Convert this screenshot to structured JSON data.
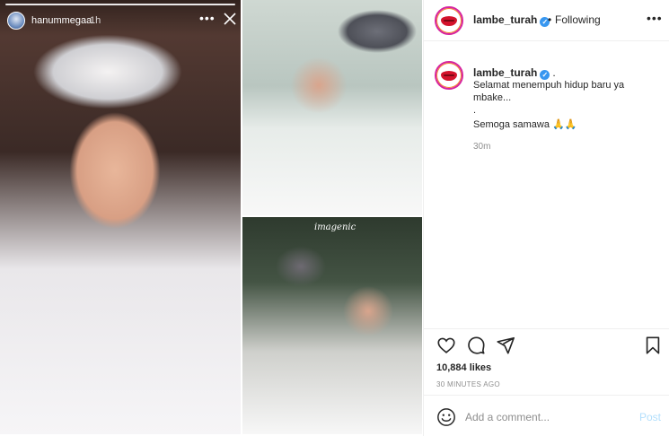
{
  "story": {
    "username": "hanummegaa",
    "time": "1h",
    "more_icon": "more-horizontal-icon",
    "close_icon": "close-icon"
  },
  "photo_watermark": "imagenic",
  "post": {
    "header": {
      "username": "lambe_turah",
      "verified_icon": "verified-badge-icon",
      "separator": "•",
      "follow_status": "Following",
      "more_icon": "more-horizontal-icon"
    },
    "caption": {
      "username": "lambe_turah",
      "suffix": ".",
      "lines": [
        "Selamat menempuh hidup baru ya",
        "mbake...",
        ".",
        "Semoga samawa 🙏🙏"
      ],
      "time": "30m"
    },
    "actions": {
      "like_icon": "heart-icon",
      "comment_icon": "comment-icon",
      "share_icon": "share-icon",
      "save_icon": "bookmark-icon"
    },
    "likes": "10,884 likes",
    "timestamp": "30 MINUTES AGO",
    "comment": {
      "emoji_icon": "emoji-icon",
      "placeholder": "Add a comment...",
      "post_label": "Post"
    }
  },
  "colors": {
    "brand_gradient_start": "#f58529",
    "brand_gradient_end": "#d6249f",
    "verified": "#3897f0",
    "post_disabled": "#b2dffc",
    "muted_text": "#8e8e8e"
  }
}
